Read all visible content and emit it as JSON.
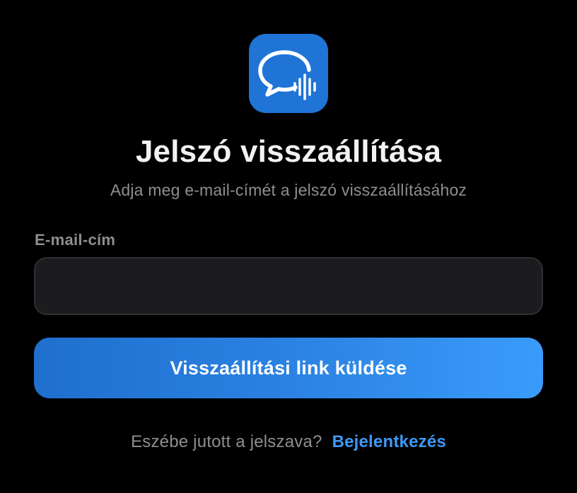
{
  "app": {
    "icon": "chat-bubble-soundwave-icon",
    "icon_bg_color": "#1f74d6"
  },
  "header": {
    "title": "Jelszó visszaállítása",
    "subtitle": "Adja meg e-mail-címét a jelszó visszaállításához"
  },
  "form": {
    "email_label": "E-mail-cím",
    "email_value": "",
    "email_placeholder": "",
    "submit_label": "Visszaállítási link küldése",
    "submit_color_start": "#1f6fce",
    "submit_color_end": "#3a9bfb"
  },
  "footer": {
    "prompt": "Eszébe jutott a jelszava?",
    "login_link": "Bejelentkezés",
    "link_color": "#3d99f5"
  }
}
